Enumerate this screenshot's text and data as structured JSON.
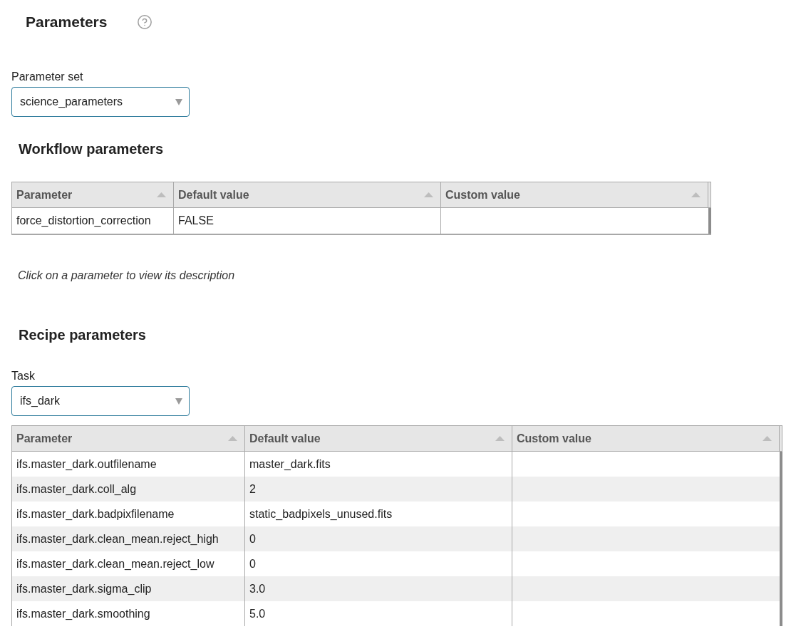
{
  "title": "Parameters",
  "parameter_set": {
    "label": "Parameter set",
    "value": "science_parameters"
  },
  "workflow_parameters": {
    "heading": "Workflow parameters",
    "columns": [
      "Parameter",
      "Default value",
      "Custom value"
    ],
    "rows": [
      {
        "parameter": "force_distortion_correction",
        "default_value": "FALSE"
      }
    ]
  },
  "hint": "Click on a parameter to view its description",
  "recipe_parameters": {
    "heading": "Recipe parameters",
    "task": {
      "label": "Task",
      "value": "ifs_dark"
    },
    "columns": [
      "Parameter",
      "Default value",
      "Custom value"
    ],
    "rows": [
      {
        "parameter": "ifs.master_dark.outfilename",
        "default_value": "master_dark.fits"
      },
      {
        "parameter": "ifs.master_dark.coll_alg",
        "default_value": "2"
      },
      {
        "parameter": "ifs.master_dark.badpixfilename",
        "default_value": "static_badpixels_unused.fits"
      },
      {
        "parameter": "ifs.master_dark.clean_mean.reject_high",
        "default_value": "0"
      },
      {
        "parameter": "ifs.master_dark.clean_mean.reject_low",
        "default_value": "0"
      },
      {
        "parameter": "ifs.master_dark.sigma_clip",
        "default_value": "3.0"
      },
      {
        "parameter": "ifs.master_dark.smoothing",
        "default_value": "5.0"
      }
    ]
  }
}
